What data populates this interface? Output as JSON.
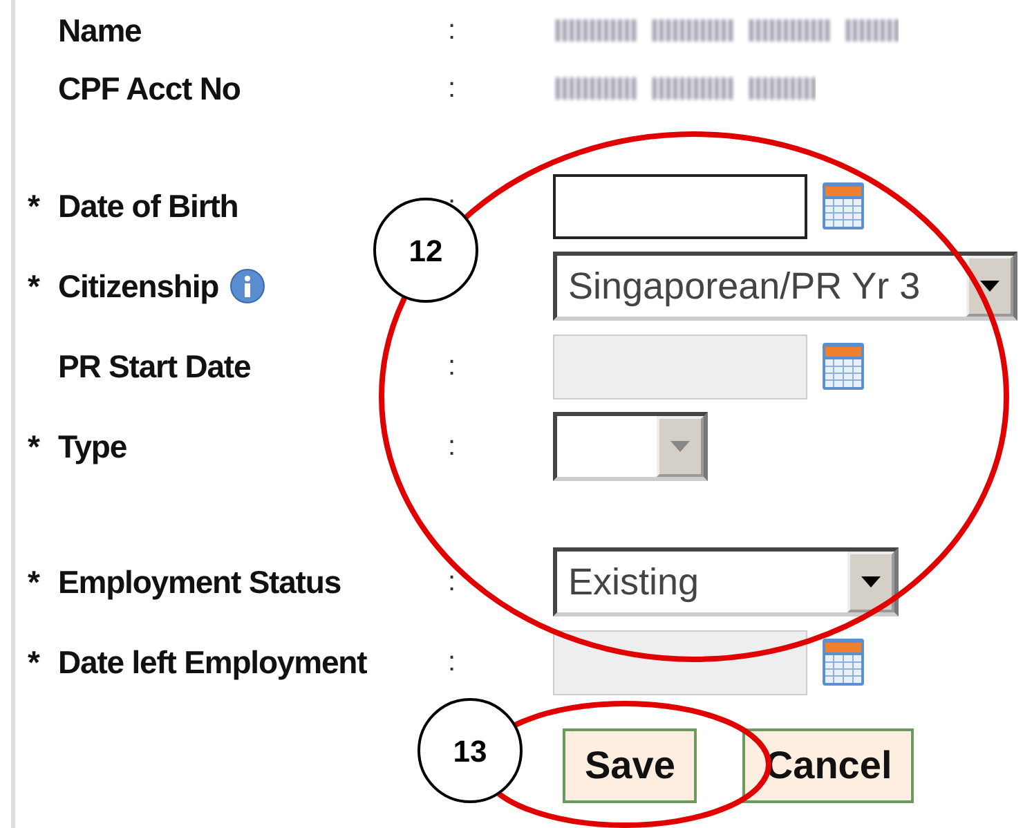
{
  "rows": [
    {
      "kind": "text",
      "label": "Name",
      "separator": ":",
      "redacted": true
    },
    {
      "kind": "text",
      "label": "CPF Acct No",
      "separator": ":",
      "redacted": true
    },
    {
      "kind": "date",
      "marker": "*",
      "label": "Date of Birth",
      "separator": ":",
      "disabled": false
    },
    {
      "kind": "select",
      "marker": "*",
      "label": "Citizenship",
      "info": true,
      "value": "Singaporean/PR Yr 3",
      "disabled": false
    },
    {
      "kind": "date",
      "label": "PR Start Date",
      "separator": ":",
      "disabled": true
    },
    {
      "kind": "select",
      "marker": "*",
      "label": "Type",
      "separator": ":",
      "disabled": true
    },
    {
      "kind": "select",
      "marker": "*",
      "label": "Employment Status",
      "separator": ":",
      "value": "Existing",
      "disabled": false
    },
    {
      "kind": "date",
      "marker": "*",
      "label": "Date left Employment",
      "separator": ":",
      "disabled": true
    }
  ],
  "buttons": [
    {
      "label": "Save"
    },
    {
      "label": "Cancel"
    }
  ],
  "annotations": [
    {
      "label": "12"
    },
    {
      "label": "13"
    }
  ]
}
